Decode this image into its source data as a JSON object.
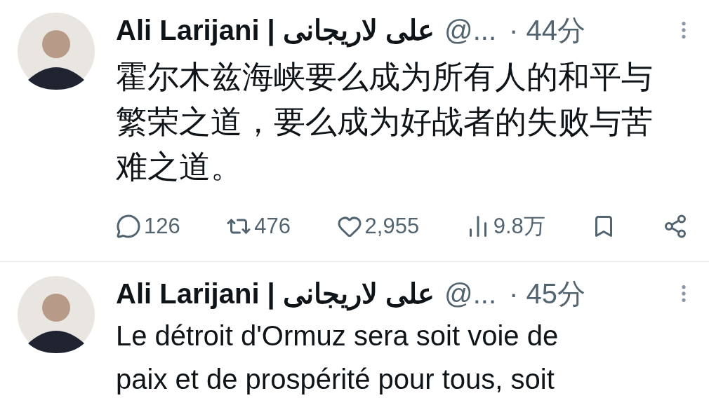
{
  "tweets": [
    {
      "name": "Ali Larijani | علی لاریجانی",
      "handle": "@...",
      "time": "· 44分",
      "lines": [
        "霍尔木兹海峡要么成为所有人的和平与",
        "繁荣之道，要么成为好战者的失败与苦",
        "难之道。"
      ],
      "actions": [
        {
          "kind": "reply",
          "count": "126"
        },
        {
          "kind": "repost",
          "count": "476"
        },
        {
          "kind": "like",
          "count": "2,955"
        },
        {
          "kind": "views",
          "count": "9.8万"
        },
        {
          "kind": "bookmark"
        },
        {
          "kind": "share"
        }
      ]
    },
    {
      "name": "Ali Larijani | علی لاریجانی",
      "handle": "@...",
      "time": "· 45分",
      "lines": [
        "Le détroit d'Ormuz sera soit voie de",
        "paix et de prospérité pour tous, soit"
      ]
    }
  ]
}
